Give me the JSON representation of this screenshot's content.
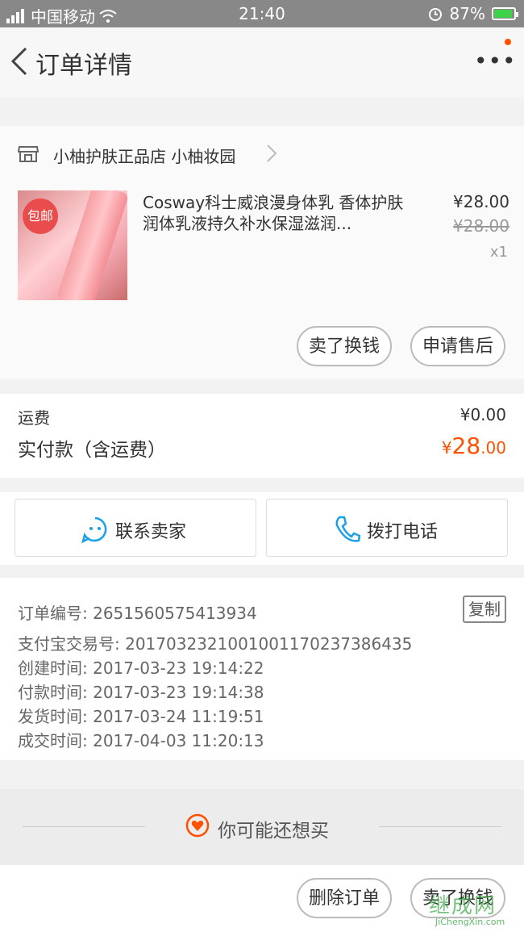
{
  "status_bar": {
    "carrier": "中国移动",
    "time": "21:40",
    "battery": "87%"
  },
  "nav": {
    "title": "订单详情"
  },
  "shop": {
    "name": "小柚护肤正品店 小柚妆园"
  },
  "item": {
    "badge": "包邮",
    "title": "Cosway科士威浪漫身体乳 香体护肤润体乳液持久补水保湿滋润...",
    "price": "¥28.00",
    "original_price": "¥28.00",
    "quantity": "x1",
    "actions": [
      "卖了换钱",
      "申请售后"
    ]
  },
  "fees": {
    "shipping_label": "运费",
    "shipping_value": "¥0.00",
    "paid_label": "实付款（含运费）",
    "paid_yen": "¥",
    "paid_int": "28",
    "paid_dec": ".00"
  },
  "contact": {
    "seller": "联系卖家",
    "call": "拨打电话"
  },
  "order_info": {
    "copy": "复制",
    "rows": [
      "订单编号: 2651560575413934",
      "支付宝交易号: 2017032321001001170237386435",
      "创建时间: 2017-03-23 19:14:22",
      "付款时间: 2017-03-23 19:14:38",
      "发货时间: 2017-03-24 11:19:51",
      "成交时间: 2017-04-03 11:20:13"
    ]
  },
  "recommend": {
    "label": "你可能还想买"
  },
  "footer": {
    "delete": "删除订单",
    "sell": "卖了换钱"
  },
  "watermark": {
    "text": "继成网",
    "url": "JiChengXin.com"
  },
  "colors": {
    "accent": "#ff5000",
    "contact_blue": "#1aa0e8"
  }
}
